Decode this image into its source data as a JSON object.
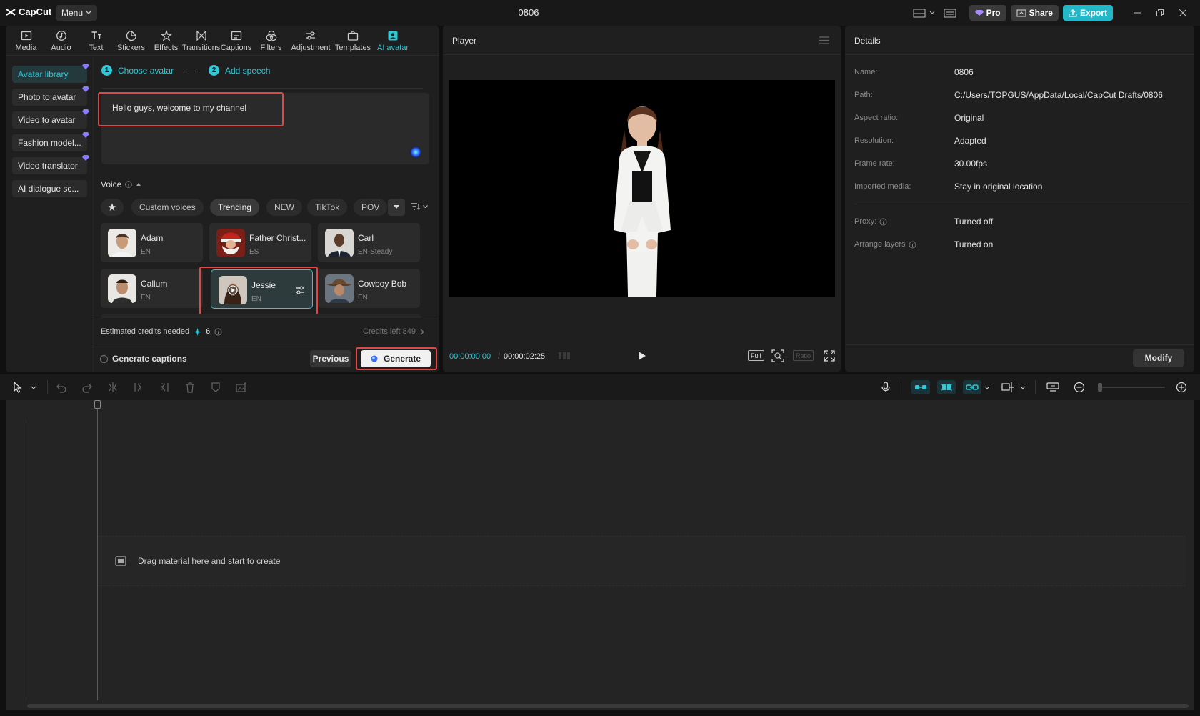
{
  "app": {
    "name": "CapCut",
    "menu": "Menu",
    "title": "0806"
  },
  "topbar": {
    "pro": "Pro",
    "share": "Share",
    "export": "Export"
  },
  "tools": [
    {
      "id": "media",
      "label": "Media"
    },
    {
      "id": "audio",
      "label": "Audio"
    },
    {
      "id": "text",
      "label": "Text"
    },
    {
      "id": "stickers",
      "label": "Stickers"
    },
    {
      "id": "effects",
      "label": "Effects"
    },
    {
      "id": "transitions",
      "label": "Transitions"
    },
    {
      "id": "captions",
      "label": "Captions"
    },
    {
      "id": "filters",
      "label": "Filters"
    },
    {
      "id": "adjustment",
      "label": "Adjustment"
    },
    {
      "id": "templates",
      "label": "Templates"
    },
    {
      "id": "ai-avatar",
      "label": "AI avatar",
      "active": true
    }
  ],
  "sidebar": {
    "items": [
      "Avatar library",
      "Photo to avatar",
      "Video to avatar",
      "Fashion model...",
      "Video translator",
      "AI dialogue sc..."
    ]
  },
  "steps": {
    "one": "Choose avatar",
    "one_num": "1",
    "two": "Add speech",
    "two_num": "2"
  },
  "script_text": "Hello guys, welcome to my channel",
  "voice": {
    "label": "Voice",
    "filters": [
      "Custom voices",
      "Trending",
      "NEW",
      "TikTok",
      "POV"
    ],
    "active_filter": "Trending",
    "cards": [
      {
        "name": "Adam",
        "lang": "EN"
      },
      {
        "name": "Father Christ...",
        "lang": "ES"
      },
      {
        "name": "Carl",
        "lang": "EN-Steady"
      },
      {
        "name": "Callum",
        "lang": "EN"
      },
      {
        "name": "Jessie",
        "lang": "EN",
        "selected": true
      },
      {
        "name": "Cowboy Bob",
        "lang": "EN"
      }
    ]
  },
  "credits": {
    "label": "Estimated credits needed",
    "value": "6",
    "left": "Credits left  849"
  },
  "actions": {
    "captions": "Generate captions",
    "previous": "Previous",
    "generate": "Generate"
  },
  "player": {
    "title": "Player",
    "current": "00:00:00:00",
    "total": "00:00:02:25",
    "full": "Full",
    "ratio": "Ratio"
  },
  "details": {
    "title": "Details",
    "rows": [
      {
        "label": "Name:",
        "value": "0806"
      },
      {
        "label": "Path:",
        "value": "C:/Users/TOPGUS/AppData/Local/CapCut Drafts/0806"
      },
      {
        "label": "Aspect ratio:",
        "value": "Original"
      },
      {
        "label": "Resolution:",
        "value": "Adapted"
      },
      {
        "label": "Frame rate:",
        "value": "30.00fps"
      },
      {
        "label": "Imported media:",
        "value": "Stay in original location"
      },
      {
        "label": "Proxy:",
        "value": "Turned off"
      },
      {
        "label": "Arrange layers",
        "value": "Turned on"
      }
    ],
    "modify": "Modify"
  },
  "timeline": {
    "drop_text": "Drag material here and start to create"
  },
  "colors": {
    "accent": "#2fc8d6",
    "highlight": "#e04848",
    "panel": "#1f1f1f"
  }
}
